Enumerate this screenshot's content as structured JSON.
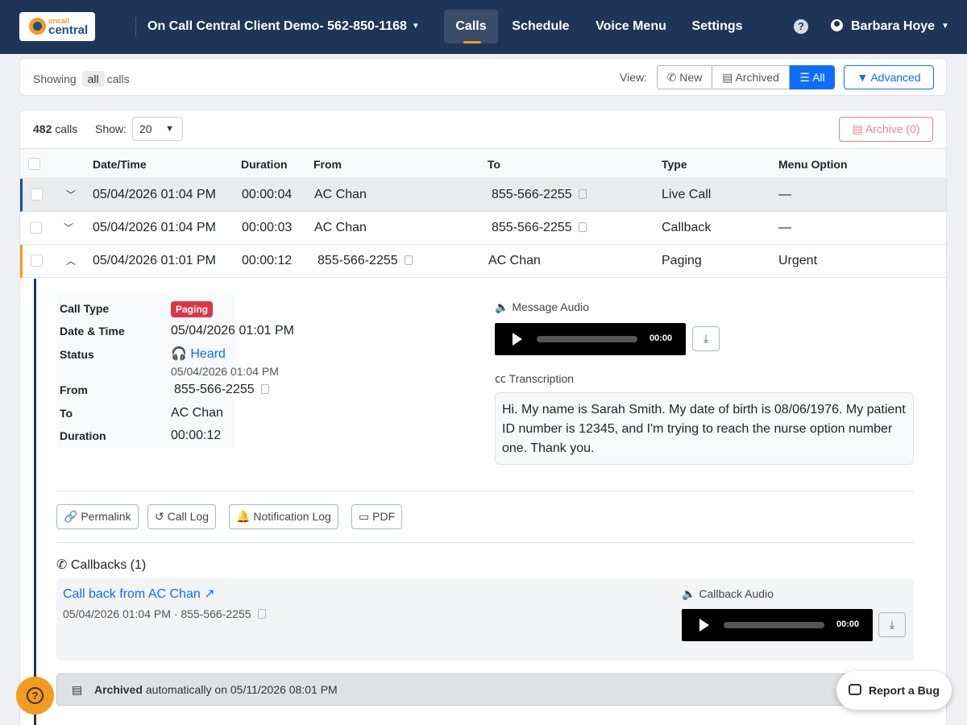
{
  "topbar": {
    "logo_top": "oncall",
    "logo_bottom": "central",
    "account": "On Call Central Client Demo- 562-850-1168",
    "nav": [
      "Calls",
      "Schedule",
      "Voice Menu",
      "Settings"
    ],
    "user": "Barbara Hoye",
    "help": "?"
  },
  "filter": {
    "showing": "Showing",
    "all": "all",
    "calls": "calls",
    "view_label": "View:",
    "views": [
      "New",
      "Archived",
      "All"
    ],
    "advanced": "Advanced"
  },
  "list": {
    "count": "482",
    "count_suffix": "calls",
    "show_label": "Show:",
    "show_value": "20",
    "archive_button": "Archive (0)",
    "columns": [
      "Date/Time",
      "Duration",
      "From",
      "To",
      "Type",
      "Menu Option"
    ],
    "rows": [
      {
        "datetime": "05/04/2026 01:04 PM",
        "duration": "00:00:04",
        "from": "AC Chan",
        "to": "855-566-2255",
        "type": "Live Call",
        "menu": "—"
      },
      {
        "datetime": "05/04/2026 01:04 PM",
        "duration": "00:00:03",
        "from": "AC Chan",
        "to": "855-566-2255",
        "type": "Callback",
        "menu": "—"
      },
      {
        "datetime": "05/04/2026 01:01 PM",
        "duration": "00:00:12",
        "from": "855-566-2255",
        "to": "AC Chan",
        "type": "Paging",
        "menu": "Urgent"
      }
    ]
  },
  "detail": {
    "labels": {
      "call_type": "Call Type",
      "datetime": "Date & Time",
      "status": "Status",
      "from": "From",
      "to": "To",
      "duration": "Duration"
    },
    "call_type": "Paging",
    "datetime": "05/04/2026 01:01 PM",
    "status": "Heard",
    "status_time": "05/04/2026 01:04 PM",
    "from": "855-566-2255",
    "to": "AC Chan",
    "duration": "00:00:12",
    "message_audio_label": "Message Audio",
    "message_audio_time": "00:00",
    "transcription_label": "Transcription",
    "transcription": "Hi. My name is Sarah Smith. My date of birth is 08/06/1976. My patient ID number is 12345, and I'm trying to reach the nurse option number one. Thank you.",
    "actions": [
      "Permalink",
      "Call Log",
      "Notification Log",
      "PDF"
    ],
    "callbacks_title": "Callbacks (1)",
    "callback_link": "Call back from AC Chan",
    "callback_meta": "05/04/2026 01:04 PM ·",
    "callback_number": "855-566-2255",
    "callback_audio_label": "Callback Audio",
    "callback_audio_time": "00:00",
    "archived_bold": "Archived",
    "archived_rest": "automatically on 05/11/2026 08:01 PM"
  },
  "footer": {
    "report_bug": "Report a Bug"
  },
  "colors": {
    "navy": "#1e3557",
    "accent": "#f39a1f",
    "primary": "#0d6efd",
    "danger": "#dc3545"
  }
}
